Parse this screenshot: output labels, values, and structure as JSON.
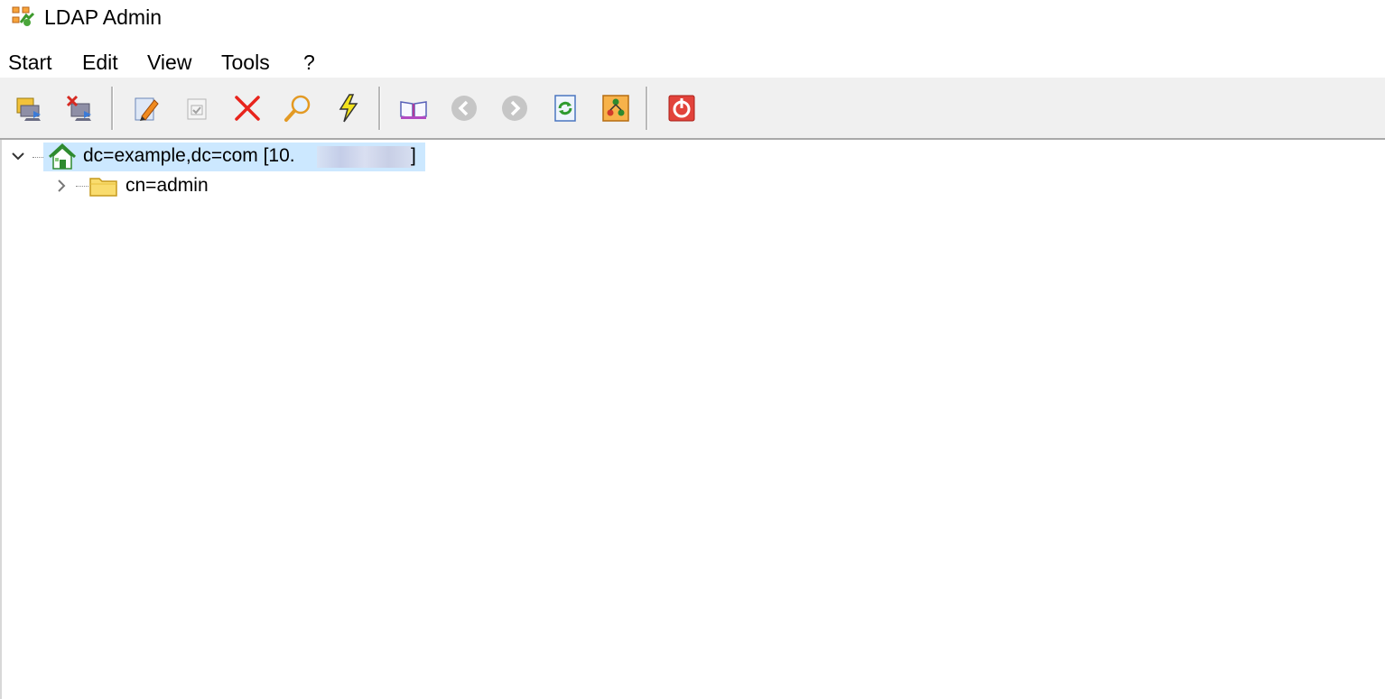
{
  "window": {
    "title": "LDAP Admin",
    "icon": "ldap-admin-app-icon"
  },
  "menu": {
    "items": [
      {
        "label": "Start"
      },
      {
        "label": "Edit"
      },
      {
        "label": "View"
      },
      {
        "label": "Tools"
      },
      {
        "label": "?"
      }
    ]
  },
  "toolbar": {
    "buttons": [
      {
        "icon": "connect-icon",
        "enabled": true
      },
      {
        "icon": "disconnect-icon",
        "enabled": true
      },
      {
        "icon": "edit-entry-icon",
        "enabled": true
      },
      {
        "icon": "save-entry-icon",
        "enabled": false
      },
      {
        "icon": "delete-icon",
        "enabled": true
      },
      {
        "icon": "search-icon",
        "enabled": true
      },
      {
        "icon": "quick-search-icon",
        "enabled": true
      },
      {
        "icon": "schema-book-icon",
        "enabled": true
      },
      {
        "icon": "back-icon",
        "enabled": false
      },
      {
        "icon": "forward-icon",
        "enabled": false
      },
      {
        "icon": "refresh-icon",
        "enabled": true
      },
      {
        "icon": "tree-view-icon",
        "enabled": true
      },
      {
        "icon": "exit-icon",
        "enabled": true
      }
    ]
  },
  "tree": {
    "root": {
      "label": "dc=example,dc=com [10.",
      "close_bracket": "]",
      "expanded": true,
      "selected": true,
      "icon": "server-home-icon"
    },
    "children": [
      {
        "label": "cn=admin",
        "expanded": false,
        "icon": "folder-icon"
      }
    ]
  },
  "colors": {
    "selection": "#cce8ff",
    "toolbar_bg": "#f0f0f0",
    "delete_red": "#e8241c",
    "exit_red": "#e2433b"
  }
}
